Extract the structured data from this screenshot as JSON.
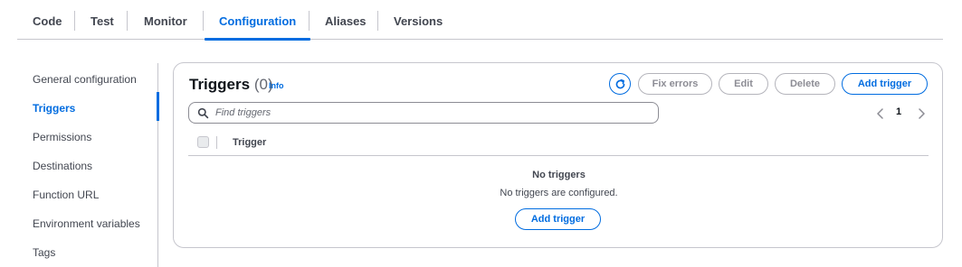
{
  "tabs": [
    {
      "label": "Code"
    },
    {
      "label": "Test"
    },
    {
      "label": "Monitor"
    },
    {
      "label": "Configuration",
      "active": true
    },
    {
      "label": "Aliases"
    },
    {
      "label": "Versions"
    }
  ],
  "sidenav": {
    "items": [
      {
        "label": "General configuration"
      },
      {
        "label": "Triggers",
        "active": true
      },
      {
        "label": "Permissions"
      },
      {
        "label": "Destinations"
      },
      {
        "label": "Function URL"
      },
      {
        "label": "Environment variables"
      },
      {
        "label": "Tags"
      }
    ]
  },
  "panel": {
    "title": "Triggers",
    "count": "(0)",
    "info_label": "Info",
    "buttons": {
      "fix_errors": "Fix errors",
      "edit": "Edit",
      "delete": "Delete",
      "add_trigger": "Add trigger"
    },
    "search": {
      "placeholder": "Find triggers",
      "value": ""
    },
    "pagination": {
      "current_page": "1"
    },
    "table": {
      "columns": [
        "Trigger"
      ]
    },
    "empty": {
      "title": "No triggers",
      "description": "No triggers are configured.",
      "button": "Add trigger"
    }
  },
  "colors": {
    "accent": "#006ce0",
    "border": "#c6c6cd",
    "text_secondary": "#424650",
    "disabled": "#8c8c94"
  },
  "icons": {
    "refresh": "refresh-icon",
    "search": "search-icon",
    "prev": "chevron-left-icon",
    "next": "chevron-right-icon"
  }
}
